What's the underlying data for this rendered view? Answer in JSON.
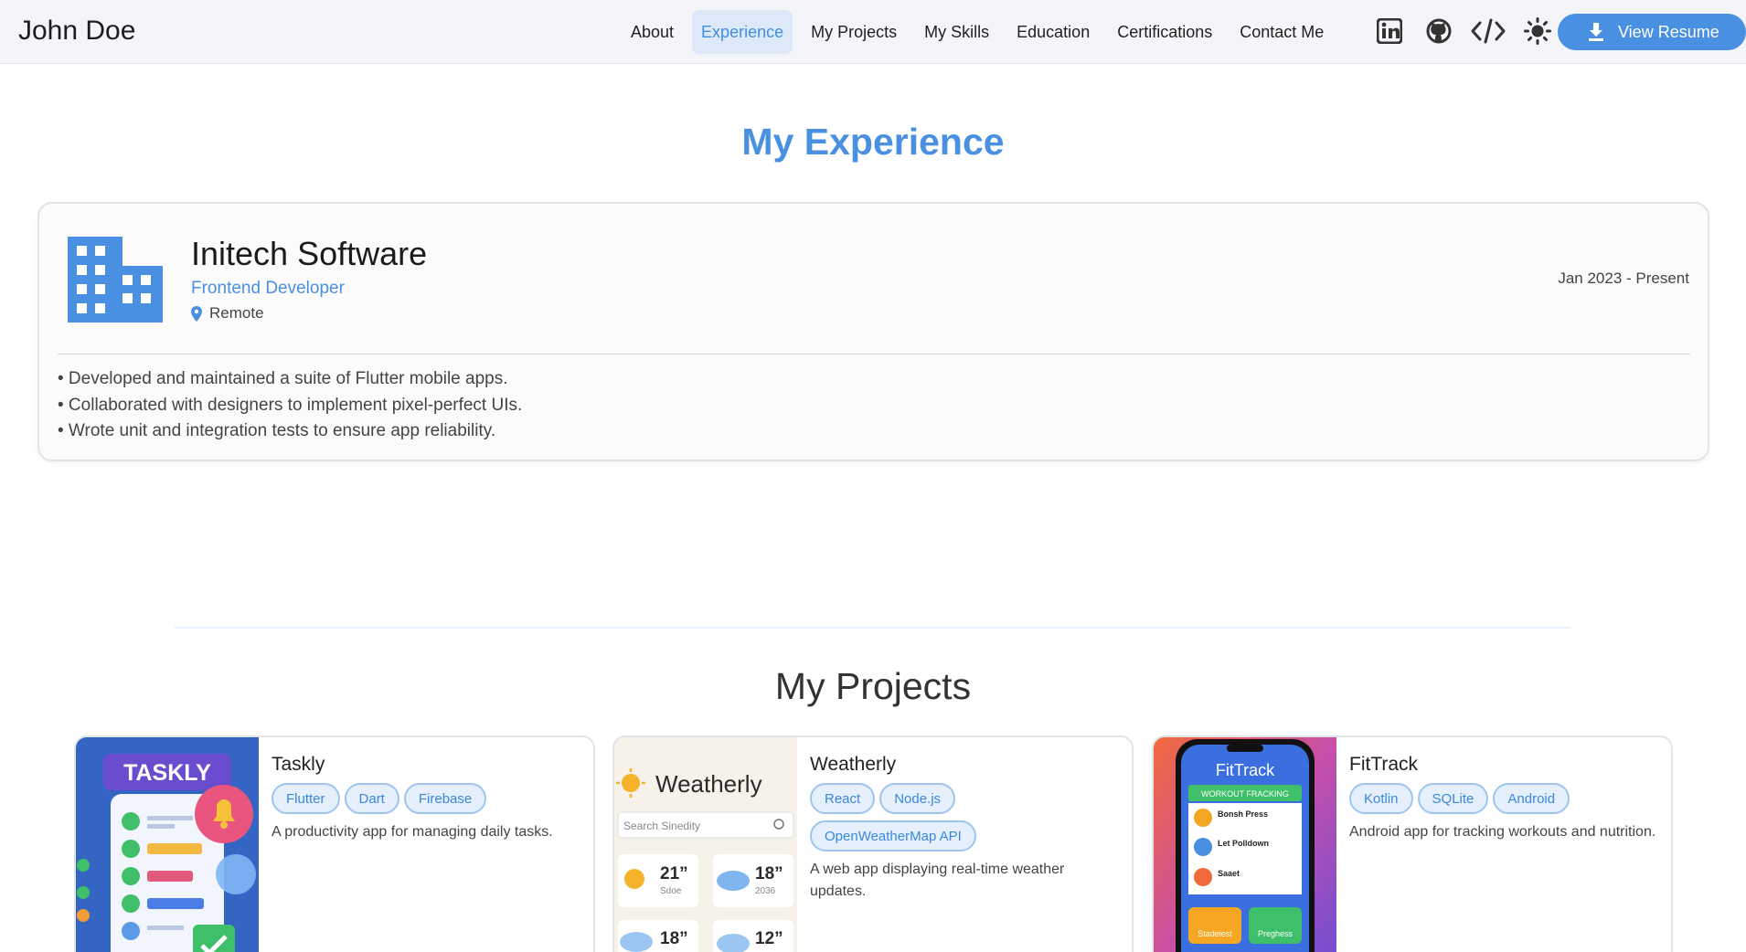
{
  "brand": "John Doe",
  "nav": {
    "items": [
      "About",
      "Experience",
      "My Projects",
      "My Skills",
      "Education",
      "Certifications",
      "Contact Me"
    ],
    "active": "Experience",
    "icons": [
      "linkedin-icon",
      "github-icon",
      "code-icon",
      "sun-icon"
    ],
    "resume_label": "View Resume"
  },
  "experience": {
    "title": "My Experience",
    "company": "Initech Software",
    "role": "Frontend Developer",
    "location": "Remote",
    "dates": "Jan 2023 - Present",
    "bullets": [
      "• Developed and maintained a suite of Flutter mobile apps.",
      "• Collaborated with designers to implement pixel-perfect UIs.",
      "• Wrote unit and integration tests to ensure app reliability."
    ]
  },
  "projects": {
    "title": "My Projects",
    "items": [
      {
        "name": "Taskly",
        "tags": [
          "Flutter",
          "Dart",
          "Firebase"
        ],
        "description": "A productivity app for managing daily tasks.",
        "thumb_text": "TASKLY"
      },
      {
        "name": "Weatherly",
        "tags": [
          "React",
          "Node.js",
          "OpenWeatherMap API"
        ],
        "description": "A web app displaying real-time weather updates.",
        "thumb_text": "Weatherly",
        "thumb_search": "Search Sinedity",
        "thumb_temps": [
          "21”",
          "18”",
          "18”",
          "12”"
        ],
        "thumb_sub": [
          "Sdoe",
          "2036"
        ]
      },
      {
        "name": "FitTrack",
        "tags": [
          "Kotlin",
          "SQLite",
          "Android"
        ],
        "description": "Android app for tracking workouts and nutrition.",
        "thumb_text": "FitTrack",
        "thumb_header": "WORKOUT FRACKING",
        "thumb_rows": [
          "Bonsh Press",
          "Let Polldown",
          "Saaet"
        ],
        "thumb_buttons": [
          "Stadeiest",
          "Preghess"
        ]
      }
    ]
  },
  "colors": {
    "accent": "#4a90e2",
    "tag_bg": "#e5f0fc",
    "nav_active_bg": "#dde9f8"
  }
}
